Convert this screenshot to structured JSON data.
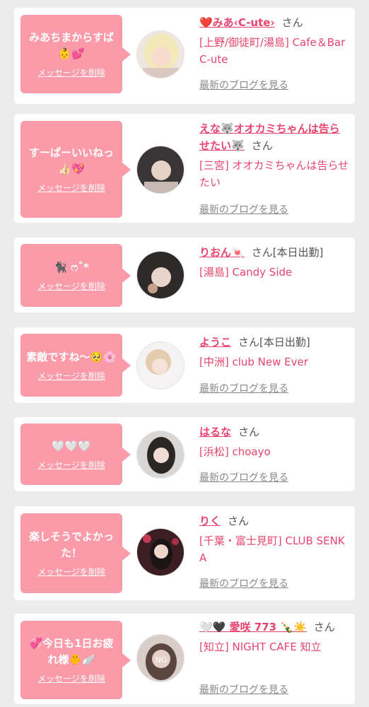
{
  "delete_label": "メッセージを削除",
  "honorific": "さん",
  "blog_link_label": "最新のブログを見る",
  "items": [
    {
      "message": "みあちまからすば👶💕",
      "name": "❤️みあ‹C-ute›",
      "status": "",
      "shop": "[上野/御徒町/湯島] Cafe＆Bar C-ute"
    },
    {
      "message": "すーぱーいいねっ👍🏻💖",
      "name": "えな🐺オオカミちゃんは告らせたい🐺",
      "status": "",
      "shop": "[三宮] オオカミちゃんは告らせたい"
    },
    {
      "message": "🐈‍⬛ ෆ˚*",
      "name": "りおん🍬",
      "status": "[本日出勤]",
      "shop": "[湯島] Candy Side"
    },
    {
      "message": "素敵ですね〜🥺🌸",
      "name": "ようこ",
      "status": "[本日出勤]",
      "shop": "[中洲] club New Ever"
    },
    {
      "message": "🤍🤍🤍",
      "name": "はるな",
      "status": "",
      "shop": "[浜松] choayo"
    },
    {
      "message": "楽しそうでよかった！",
      "name": "りく",
      "status": "",
      "shop": "[千葉・富士見町] CLUB SENKA"
    },
    {
      "message": "💞今日も1日お疲れ様🐥🪽",
      "name": "🤍🖤 愛咲 773 🍾☀️",
      "status": "",
      "shop": "[知立] NIGHT CAFE 知立"
    }
  ]
}
